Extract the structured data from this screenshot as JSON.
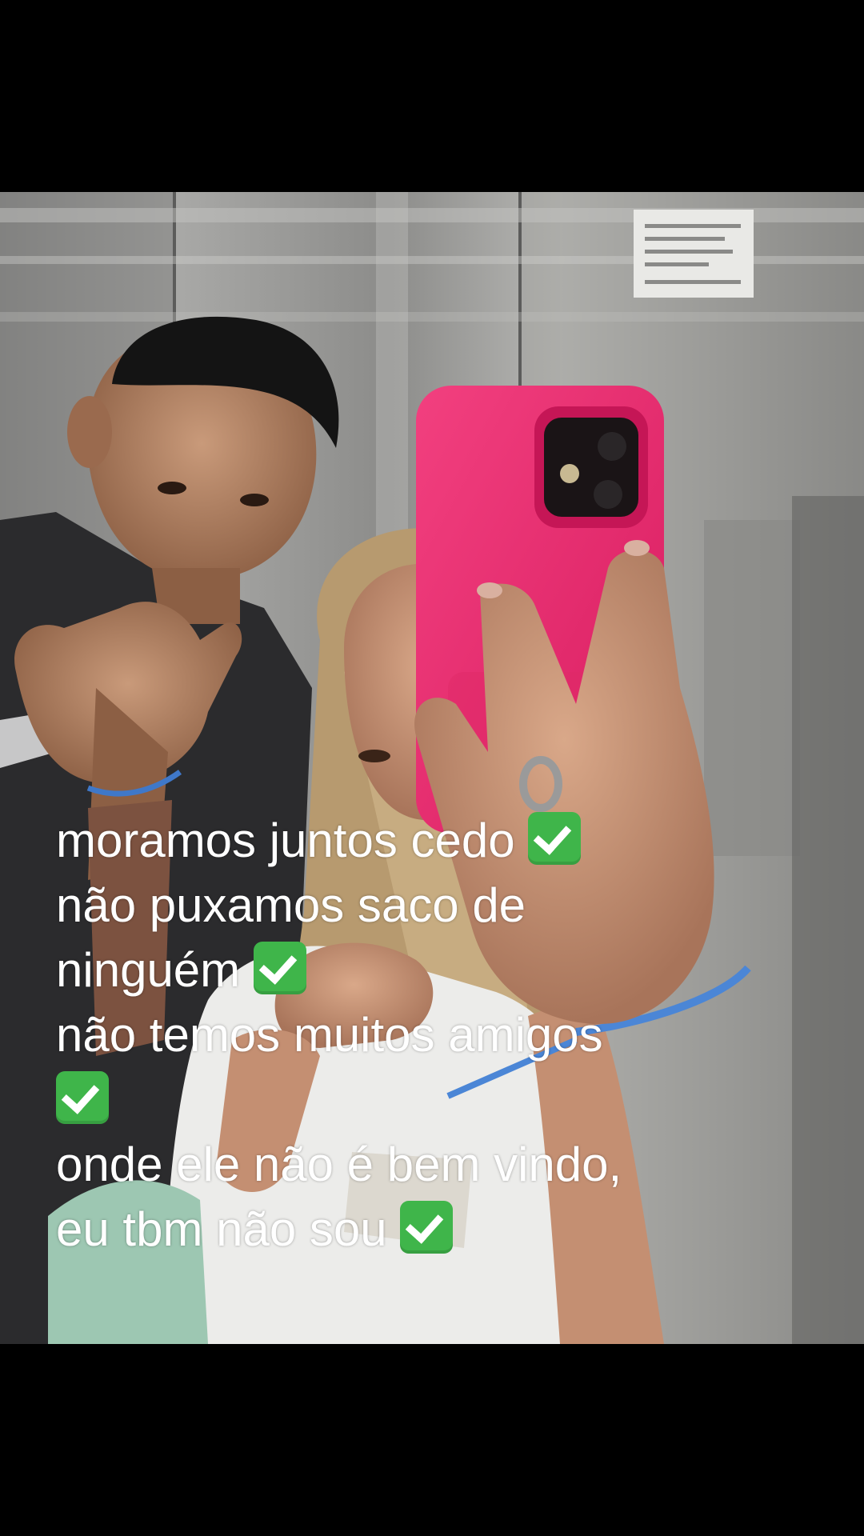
{
  "caption": {
    "lines": [
      "moramos juntos cedo",
      "não puxamos saco de",
      "ninguém",
      "não temos muitos amigos",
      "onde ele não é bem vindo,",
      "eu tbm não sou"
    ],
    "emoji": "check-mark-button-icon",
    "emoji_color": "#3fb54a"
  },
  "photo": {
    "phone_case_color": "#e8236a"
  }
}
